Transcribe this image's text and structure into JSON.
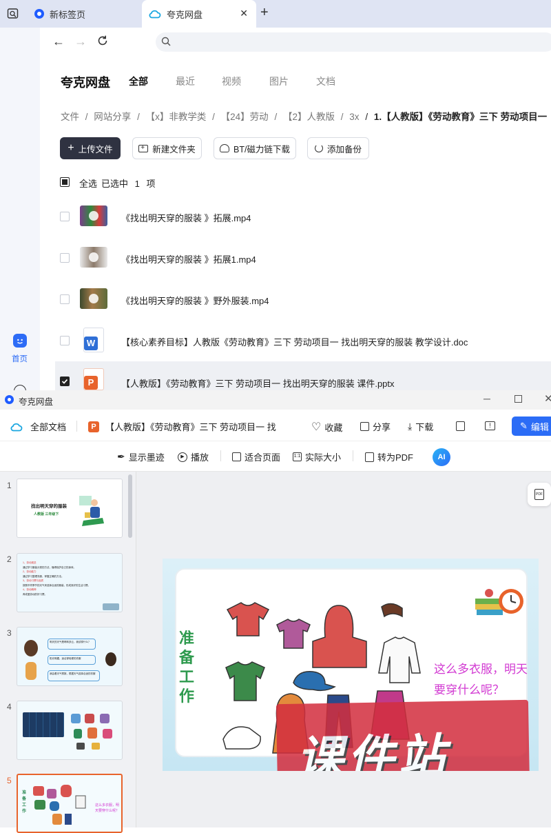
{
  "browser": {
    "tabs": [
      {
        "label": "新标签页",
        "active": false
      },
      {
        "label": "夸克网盘",
        "active": true
      }
    ],
    "address_value": ""
  },
  "leftnav": {
    "home_label": "首页"
  },
  "drive": {
    "brand": "夸克网盘",
    "category_tabs": [
      "全部",
      "最近",
      "视频",
      "图片",
      "文档"
    ],
    "breadcrumb": [
      "文件",
      "网站分享",
      "【x】非教学类",
      "【24】劳动",
      "【2】人教版",
      "3x",
      "1.【人教版】《劳动教育》三下 劳动项目一"
    ],
    "actions": {
      "upload": "上传文件",
      "new_folder": "新建文件夹",
      "bt": "BT/磁力链下载",
      "backup": "添加备份"
    },
    "selection": {
      "select_all": "全选",
      "selected_prefix": "已选中",
      "count": "1",
      "unit": "项"
    },
    "files": [
      {
        "name": "《找出明天穿的服装 》拓展.mp4",
        "type": "video",
        "checked": false
      },
      {
        "name": "《找出明天穿的服装 》拓展1.mp4",
        "type": "video",
        "checked": false
      },
      {
        "name": "《找出明天穿的服装 》野外服装.mp4",
        "type": "video",
        "checked": false
      },
      {
        "name": "【核心素养目标】人教版《劳动教育》三下 劳动项目一 找出明天穿的服装  教学设计.doc",
        "type": "doc",
        "checked": false
      },
      {
        "name": "【人教版】《劳动教育》三下 劳动项目一 找出明天穿的服装  课件.pptx",
        "type": "pptx",
        "checked": true
      }
    ]
  },
  "viewer": {
    "window_title": "夸克网盘",
    "all_docs": "全部文档",
    "doc_title": "【人教版】《劳动教育》三下 劳动项目一 找",
    "favorite": "收藏",
    "share": "分享",
    "download": "下载",
    "edit": "编辑",
    "toolbar": {
      "show_ink": "显示墨迹",
      "play": "播放",
      "fit_page": "适合页面",
      "actual_size": "实际大小",
      "to_pdf": "转为PDF",
      "ai_label": "AI"
    },
    "slides": [
      {
        "num": "1",
        "title": "找出明天穿的服装",
        "subtitle": "人教版 三年级下"
      },
      {
        "num": "2",
        "lines": [
          "1、劳动观念",
          "通过学习服装分类的方法，懂得保护自己的身体。",
          "2、劳动能力",
          "通过学习整理衣服，掌握正确的方法。",
          "3、劳动习惯与品质",
          "按照不同季节的天气来选择合适的服装，形成良好的生活习惯。",
          "4、劳动精神",
          "养成爱劳动的好习惯。"
        ]
      },
      {
        "num": "3",
        "bubbles": [
          "明天的天气是晴转多云，我该穿什么？",
          "阳光明媚，适合穿轻便的衣服",
          "我会看天气预报，根据天气选择合适的衣服"
        ]
      },
      {
        "num": "4"
      },
      {
        "num": "5",
        "text": "这么多衣服，明天要穿什么呢？",
        "side": "准备工作"
      }
    ],
    "current_slide": {
      "side_text": "准备工作",
      "question": "这么多衣服，明天要穿什么呢？",
      "watermark": "课件站"
    }
  }
}
